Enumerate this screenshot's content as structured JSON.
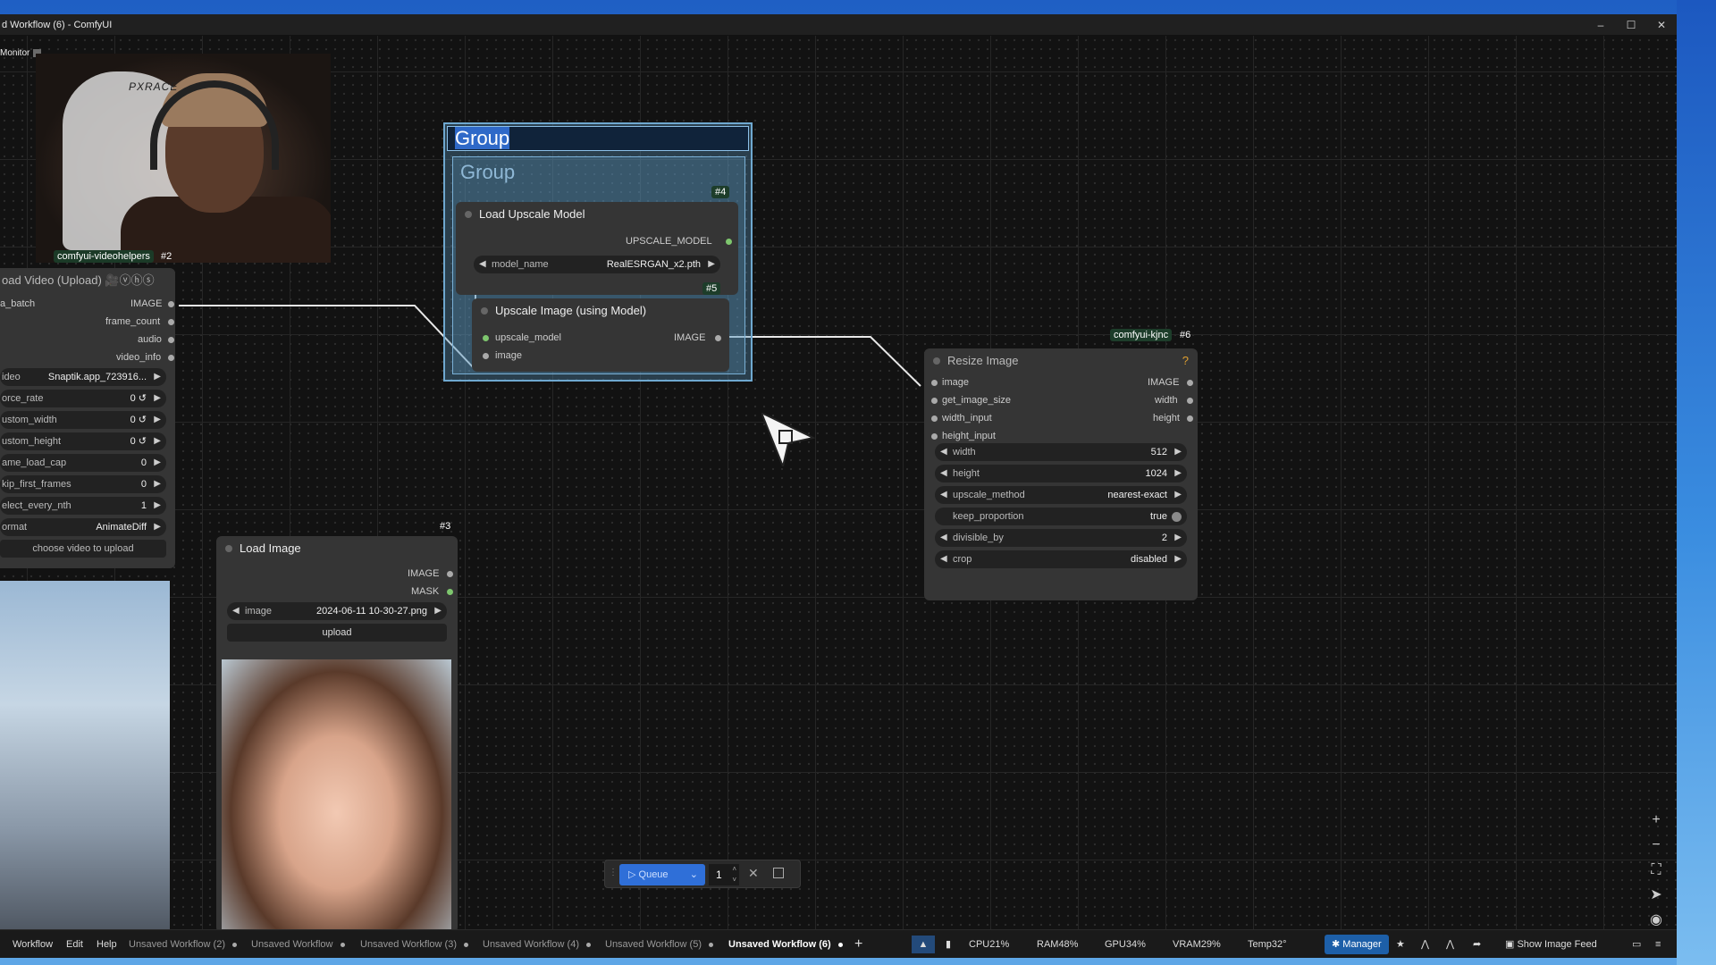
{
  "window": {
    "title": "d Workflow (6) - ComfyUI",
    "controls": [
      "–",
      "☐",
      "✕"
    ]
  },
  "monitor": {
    "label": "Monitor"
  },
  "webcam": {
    "brand": "PXRACE"
  },
  "nodes": {
    "video_helper": {
      "badge_name": "comfyui-videohelpers",
      "badge_id": "#2",
      "title": "oad Video (Upload) 🎥ⓥⓗⓢ",
      "outputs": [
        "a_batch",
        "frame_count",
        "audio",
        "video_info"
      ],
      "output_types": [
        "IMAGE"
      ],
      "widgets": [
        {
          "label": "ideo",
          "value": "Snaptik.app_723916..."
        },
        {
          "label": "orce_rate",
          "value": "0 ↺"
        },
        {
          "label": "ustom_width",
          "value": "0 ↺"
        },
        {
          "label": "ustom_height",
          "value": "0 ↺"
        },
        {
          "label": "ame_load_cap",
          "value": "0"
        },
        {
          "label": "kip_first_frames",
          "value": "0"
        },
        {
          "label": "elect_every_nth",
          "value": "1"
        },
        {
          "label": "ormat",
          "value": "AnimateDiff"
        }
      ],
      "button": "choose video to upload"
    },
    "group": {
      "title": "Group",
      "inner_title": "Group"
    },
    "load_upscale": {
      "id": "#4",
      "title": "Load Upscale Model",
      "output": "UPSCALE_MODEL",
      "widget_label": "model_name",
      "widget_value": "RealESRGAN_x2.pth"
    },
    "upscale_image": {
      "id": "#5",
      "title": "Upscale Image (using Model)",
      "inputs": [
        "upscale_model",
        "image"
      ],
      "output": "IMAGE"
    },
    "load_image": {
      "id": "#3",
      "title": "Load Image",
      "outputs": [
        "IMAGE",
        "MASK"
      ],
      "widget_label": "image",
      "widget_value": "2024-06-11 10-30-27.png",
      "button": "upload"
    },
    "resize_image": {
      "badge_name": "comfyui-kjnc",
      "badge_id": "#6",
      "title": "Resize Image",
      "help": "?",
      "inputs": [
        "image",
        "get_image_size",
        "width_input",
        "height_input"
      ],
      "outputs": [
        "IMAGE",
        "width",
        "height"
      ],
      "widgets": [
        {
          "label": "width",
          "value": "512"
        },
        {
          "label": "height",
          "value": "1024"
        },
        {
          "label": "upscale_method",
          "value": "nearest-exact"
        },
        {
          "label": "keep_proportion",
          "value": "true"
        },
        {
          "label": "divisible_by",
          "value": "2"
        },
        {
          "label": "crop",
          "value": "disabled"
        }
      ]
    }
  },
  "queue": {
    "label": "Queue",
    "count": "1"
  },
  "menu": [
    "Workflow",
    "Edit",
    "Help"
  ],
  "tabs": [
    {
      "label": "Unsaved Workflow (2)",
      "active": false
    },
    {
      "label": "Unsaved Workflow",
      "active": false
    },
    {
      "label": "Unsaved Workflow (3)",
      "active": false
    },
    {
      "label": "Unsaved Workflow (4)",
      "active": false
    },
    {
      "label": "Unsaved Workflow (5)",
      "active": false
    },
    {
      "label": "Unsaved Workflow (6)",
      "active": true
    }
  ],
  "stats": {
    "cpu": "CPU21%",
    "ram": "RAM48%",
    "gpu": "GPU34%",
    "vram": "VRAM29%",
    "temp": "Temp32°"
  },
  "toolbar": {
    "manager": "Manager",
    "show_image_feed": "Show Image Feed"
  },
  "colors": {
    "accent": "#2f6fd8",
    "group": "#6fa8d0",
    "node": "#353535",
    "canvas": "#121212"
  }
}
